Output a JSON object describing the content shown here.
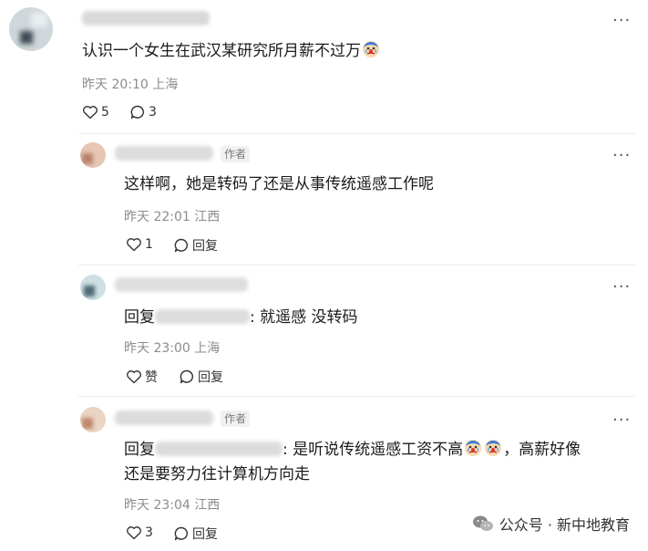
{
  "comments": [
    {
      "text": "认识一个女生在武汉某研究所月薪不过万",
      "time": "昨天 20:10",
      "location": "上海",
      "likes": "5",
      "replies": "3",
      "emoji": "clown-crying-icon"
    },
    {
      "author_tag": "作者",
      "text": "这样啊，她是转码了还是从事传统遥感工作呢",
      "time": "昨天 22:01",
      "location": "江西",
      "likes": "1",
      "reply_label": "回复"
    },
    {
      "reply_prefix": "回复",
      "text": ": 就遥感 没转码",
      "time": "昨天 23:00",
      "location": "上海",
      "like_label": "赞",
      "reply_label": "回复"
    },
    {
      "author_tag": "作者",
      "reply_prefix": "回复",
      "text_line1_a": ": 是听说传统遥感工资不高",
      "text_line1_b": "，高薪好像",
      "text_line2": "还是要努力往计算机方向走",
      "time": "昨天 23:04",
      "location": "江西",
      "likes": "3",
      "reply_label": "回复"
    }
  ],
  "more_label": "···",
  "watermark": {
    "icon": "wechat-icon",
    "text": "公众号 · 新中地教育"
  },
  "colors": {
    "meta": "#8c8c8c",
    "text": "#1b1b1b",
    "tag_bg": "#f1f1f1"
  }
}
